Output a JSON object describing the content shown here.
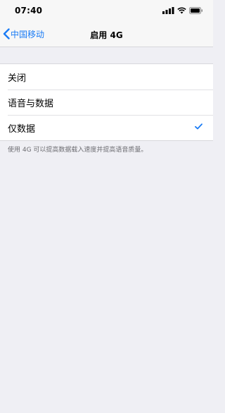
{
  "status_bar": {
    "time": "07:40"
  },
  "nav": {
    "back_label": "中国移动",
    "title": "启用 4G"
  },
  "options": [
    {
      "label": "关闭",
      "selected": false
    },
    {
      "label": "语音与数据",
      "selected": false
    },
    {
      "label": "仅数据",
      "selected": true
    }
  ],
  "footer": {
    "note": "使用 4G 可以提高数据载入速度并提高语音质量。"
  },
  "colors": {
    "accent": "#1b7cf5",
    "background": "#efeff4",
    "bar": "#f7f7f7"
  }
}
